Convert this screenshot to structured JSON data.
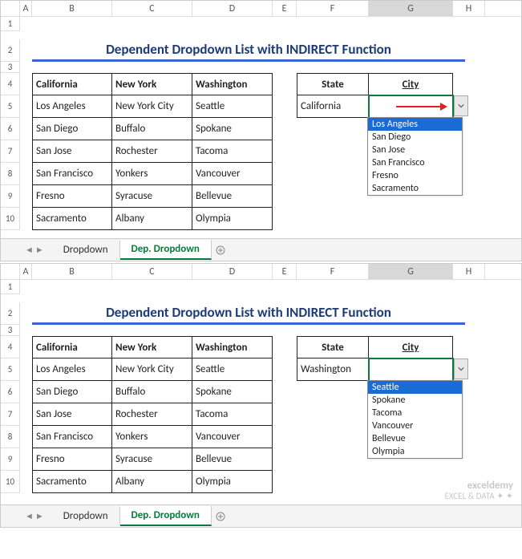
{
  "title": "Dependent Dropdown List with INDIRECT Function",
  "column_letters": [
    "A",
    "B",
    "C",
    "D",
    "E",
    "F",
    "G",
    "H"
  ],
  "row_numbers": [
    "1",
    "2",
    "3",
    "4",
    "5",
    "6",
    "7",
    "8",
    "9",
    "10"
  ],
  "source_headers": [
    "California",
    "New York",
    "Washington"
  ],
  "source_data": [
    [
      "Los Angeles",
      "New York City",
      "Seattle"
    ],
    [
      "San Diego",
      "Buffalo",
      "Spokane"
    ],
    [
      "San Jose",
      "Rochester",
      "Tacoma"
    ],
    [
      "San Francisco",
      "Yonkers",
      "Vancouver"
    ],
    [
      "Fresno",
      "Syracuse",
      "Bellevue"
    ],
    [
      "Sacramento",
      "Albany",
      "Olympia"
    ]
  ],
  "lookup_headers": {
    "state": "State",
    "city": "City"
  },
  "tabs": {
    "tab1": "Dropdown",
    "tab2": "Dep. Dropdown"
  },
  "pane1": {
    "state_value": "California",
    "dropdown_options": [
      "Los Angeles",
      "San Diego",
      "San Jose",
      "San Francisco",
      "Fresno",
      "Sacramento"
    ]
  },
  "pane2": {
    "state_value": "Washington",
    "dropdown_options": [
      "Seattle",
      "Spokane",
      "Tacoma",
      "Vancouver",
      "Bellevue",
      "Olympia"
    ]
  },
  "watermark": {
    "line1": "exceldemy",
    "line2": "EXCEL & DATA ✦ ✦"
  }
}
